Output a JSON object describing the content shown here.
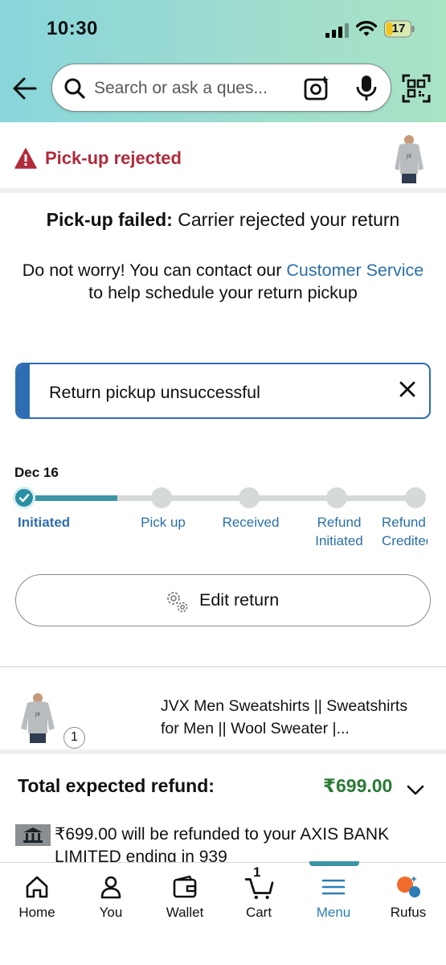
{
  "status_bar": {
    "time": "10:30",
    "battery": "17"
  },
  "search": {
    "placeholder": "Search or ask a ques..."
  },
  "return_status": {
    "title": "Pick-up rejected"
  },
  "message": {
    "bold": "Pick-up failed:",
    "line1": " Carrier rejected your return",
    "line2_pre": "Do not worry! You can contact our ",
    "link": "Customer Service",
    "line2_post": " to help schedule your return pickup"
  },
  "alert": {
    "text": "Return pickup unsuccessful"
  },
  "tracker": {
    "date": "Dec 16",
    "progress": 0.25,
    "steps": [
      {
        "label": "Initiated",
        "done": true
      },
      {
        "label": "Pick up",
        "done": false
      },
      {
        "label": "Received",
        "done": false
      },
      {
        "label": "Refund Initiated",
        "done": false
      },
      {
        "label": "Refund Credited",
        "done": false
      }
    ]
  },
  "edit_button": {
    "label": "Edit return"
  },
  "product": {
    "title": "JVX Men Sweatshirts || Sweatshirts for Men || Wool Sweater |...",
    "quantity": "1"
  },
  "refund": {
    "label": "Total expected refund:",
    "amount": "₹699.00",
    "note": "₹699.00 will be refunded to your AXIS BANK LIMITED ending in 939"
  },
  "bottom_nav": {
    "items": [
      {
        "label": "Home"
      },
      {
        "label": "You"
      },
      {
        "label": "Wallet"
      },
      {
        "label": "Cart",
        "badge": "1"
      },
      {
        "label": "Menu"
      },
      {
        "label": "Rufus"
      }
    ]
  },
  "colors": {
    "accent": "#3d94a4",
    "error": "#b12a3b",
    "link": "#2a6fa8",
    "price": "#2a7a34",
    "alert_border": "#2f6db3"
  }
}
